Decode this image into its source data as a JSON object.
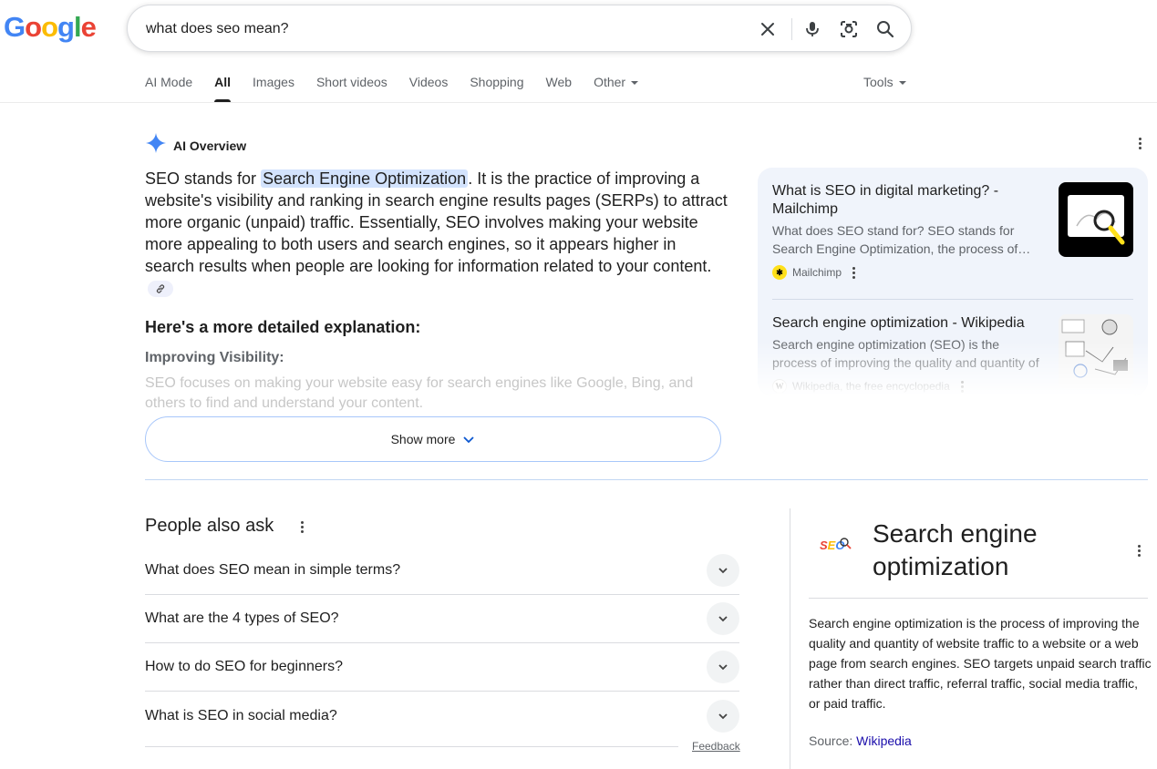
{
  "logo": "Google",
  "search": {
    "query": "what does seo mean?"
  },
  "tabs": [
    {
      "label": "AI Mode"
    },
    {
      "label": "All"
    },
    {
      "label": "Images"
    },
    {
      "label": "Short videos"
    },
    {
      "label": "Videos"
    },
    {
      "label": "Shopping"
    },
    {
      "label": "Web"
    },
    {
      "label": "Other"
    }
  ],
  "tools_label": "Tools",
  "ai_overview": {
    "title": "AI Overview",
    "intro_before": "SEO stands for ",
    "intro_highlight": "Search Engine Optimization",
    "intro_after": ". It is the practice of improving a website's visibility and ranking in search engine results pages (SERPs) to attract more organic (unpaid) traffic. Essentially, SEO involves making your website more appealing to both users and search engines, so it appears higher in search results when people are looking for information related to your content.",
    "subheading": "Here's a more detailed explanation:",
    "section_title": "Improving Visibility:",
    "section_text": "SEO focuses on making your website easy for search engines like Google, Bing, and others to find and understand your content.",
    "show_more": "Show more"
  },
  "sources": [
    {
      "title": "What is SEO in digital marketing? - Mailchimp",
      "desc": "What does SEO stand for? SEO stands for Search Engine Optimization, the process of…",
      "site": "Mailchimp"
    },
    {
      "title": "Search engine optimization - Wikipedia",
      "desc": "Search engine optimization (SEO) is the process of improving the quality and quantity of websit…",
      "site": "Wikipedia, the free encyclopedia"
    }
  ],
  "people_also_ask": {
    "title": "People also ask",
    "questions": [
      "What does SEO mean in simple terms?",
      "What are the 4 types of SEO?",
      "How to do SEO for beginners?",
      "What is SEO in social media?"
    ],
    "feedback": "Feedback"
  },
  "knowledge_panel": {
    "logo_text": "SEO",
    "title": "Search engine optimization",
    "description": "Search engine optimization is the process of improving the quality and quantity of website traffic to a website or a web page from search engines. SEO targets unpaid search traffic rather than direct traffic, referral traffic, social media traffic, or paid traffic.",
    "source_label": "Source: ",
    "source_link": "Wikipedia"
  },
  "colors": {
    "accent_blue": "#4285f4",
    "link": "#1a0dab",
    "highlight": "#d3e3fd"
  },
  "icons": [
    "clear-icon",
    "microphone-icon",
    "lens-icon",
    "search-icon",
    "sparkle-icon",
    "link-icon",
    "chevron-down-icon",
    "more-vert-icon"
  ]
}
